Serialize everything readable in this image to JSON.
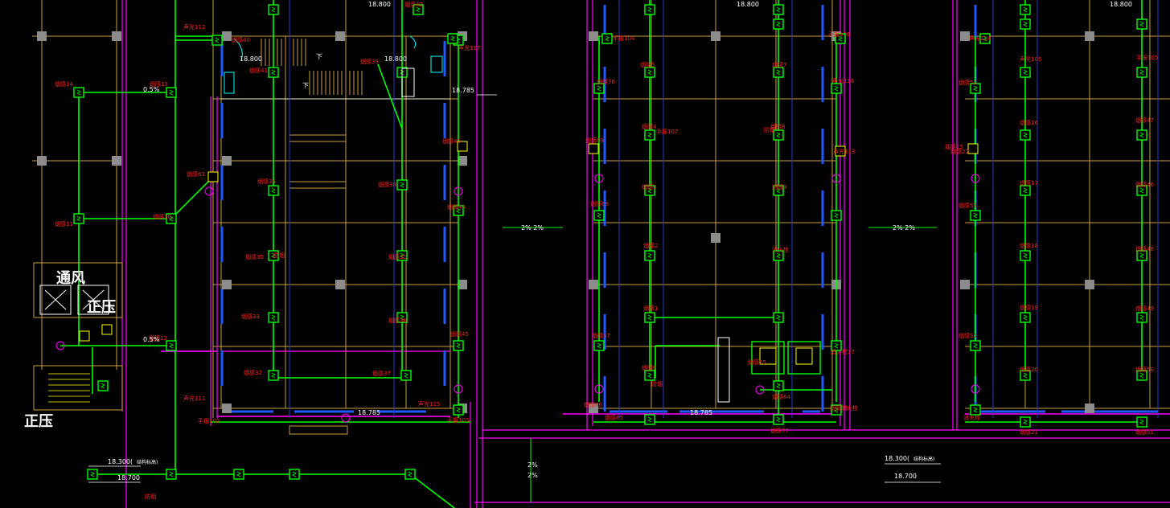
{
  "colors": {
    "background": "#000000",
    "grid": "#c8a03c",
    "wall": "#ff00ff",
    "wire": "#00ff00",
    "pipe": "#1e5aff",
    "label": "#ff2020",
    "dim": "#ffffff",
    "column": "#8c8c8c",
    "cyan": "#00ffff"
  },
  "levels": {
    "top": "18.800",
    "l1": "18.300(",
    "l1_suffix": "结构标高)",
    "l2": "18.700",
    "floor": "18.785",
    "stair": "18.800",
    "side": "18.785"
  },
  "slopes": {
    "h": "2%  2%",
    "v1": "2%",
    "v2": "2%",
    "s1": "0.5%"
  },
  "rooms": {
    "pressure": "正压",
    "ventilation": "通风"
  },
  "stair_mark": "下",
  "labels": [
    {
      "t": "声光112"
    },
    {
      "t": "烟感14"
    },
    {
      "t": "烟感13"
    },
    {
      "t": "烟感11"
    },
    {
      "t": "烟感10"
    },
    {
      "t": "烟感12"
    },
    {
      "t": "声光111"
    },
    {
      "t": "手报102"
    },
    {
      "t": "烟感63"
    },
    {
      "t": "烟感35"
    },
    {
      "t": "烟感34"
    },
    {
      "t": "烟感33"
    },
    {
      "t": "烟感32"
    },
    {
      "t": "烟感31"
    },
    {
      "t": "烟感36"
    },
    {
      "t": "烟感37"
    },
    {
      "t": "烟感38"
    },
    {
      "t": "烟感39"
    },
    {
      "t": "烟感40"
    },
    {
      "t": "烟感41"
    },
    {
      "t": "烟感42"
    },
    {
      "t": "烟感43"
    },
    {
      "t": "烟感44"
    },
    {
      "t": "烟感45"
    },
    {
      "t": "手报103"
    },
    {
      "t": "声光115"
    },
    {
      "t": "声光117"
    },
    {
      "t": "烟感5"
    },
    {
      "t": "烟感4"
    },
    {
      "t": "烟感3"
    },
    {
      "t": "烟感2"
    },
    {
      "t": "烟感1"
    },
    {
      "t": "烟感6"
    },
    {
      "t": "烟感7"
    },
    {
      "t": "烟感8"
    },
    {
      "t": "烟感9"
    },
    {
      "t": "消火栓"
    },
    {
      "t": "烟感69"
    },
    {
      "t": "烟感68"
    },
    {
      "t": "烟感67"
    },
    {
      "t": "烟感66"
    },
    {
      "t": "烟感65"
    },
    {
      "t": "手报104"
    },
    {
      "t": "声光105"
    },
    {
      "t": "烟感16"
    },
    {
      "t": "烟感17"
    },
    {
      "t": "烟感18"
    },
    {
      "t": "烟感19"
    },
    {
      "t": "烟感20"
    },
    {
      "t": "烟感21"
    },
    {
      "t": "烟感22"
    },
    {
      "t": "声光113"
    },
    {
      "t": "消火栓37"
    },
    {
      "t": "烟感64"
    },
    {
      "t": "烟感77"
    },
    {
      "t": "烟感76"
    },
    {
      "t": "烟感15"
    },
    {
      "t": "消火栓"
    },
    {
      "t": "手报105"
    },
    {
      "t": "烟感47"
    },
    {
      "t": "烟感46"
    },
    {
      "t": "烟感48"
    },
    {
      "t": "烟感49"
    },
    {
      "t": "烟感50"
    },
    {
      "t": "烟感51"
    },
    {
      "t": "烟感52"
    },
    {
      "t": "烟感53"
    },
    {
      "t": "烟感54"
    },
    {
      "t": "烟感55"
    },
    {
      "t": "烟感56"
    },
    {
      "t": "消火栓"
    },
    {
      "t": "声光114"
    },
    {
      "t": "手报106"
    },
    {
      "t": "声光116"
    },
    {
      "t": "手报107"
    },
    {
      "t": "防烟"
    },
    {
      "t": "防烟"
    },
    {
      "t": "防烟"
    },
    {
      "t": "防烟"
    }
  ]
}
